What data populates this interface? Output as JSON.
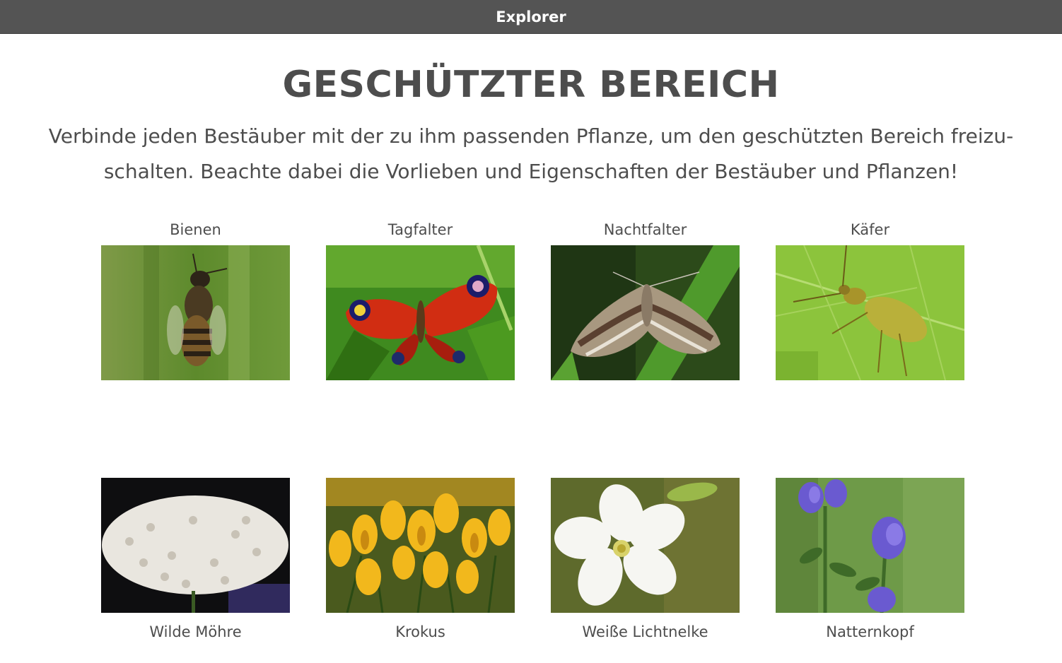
{
  "window": {
    "title": "Explorer"
  },
  "page": {
    "heading": "GESCHÜTZTER BEREICH",
    "intro": "Verbinde jeden Bestäuber mit der zu ihm passenden Pflanze, um den geschützten Bereich freizu-schalten. Beachte dabei die Vorlieben und Eigenschaften der Bestäuber und Pflanzen!"
  },
  "pollinators": [
    {
      "label": "Bienen"
    },
    {
      "label": "Tagfalter"
    },
    {
      "label": "Nachtfalter"
    },
    {
      "label": "Käfer"
    }
  ],
  "plants": [
    {
      "label": "Wilde Möhre"
    },
    {
      "label": "Krokus"
    },
    {
      "label": "Weiße Lichtnelke"
    },
    {
      "label": "Natternkopf"
    }
  ],
  "colors": {
    "titlebar": "#545454",
    "text": "#4d4d4d",
    "background": "#ffffff"
  }
}
